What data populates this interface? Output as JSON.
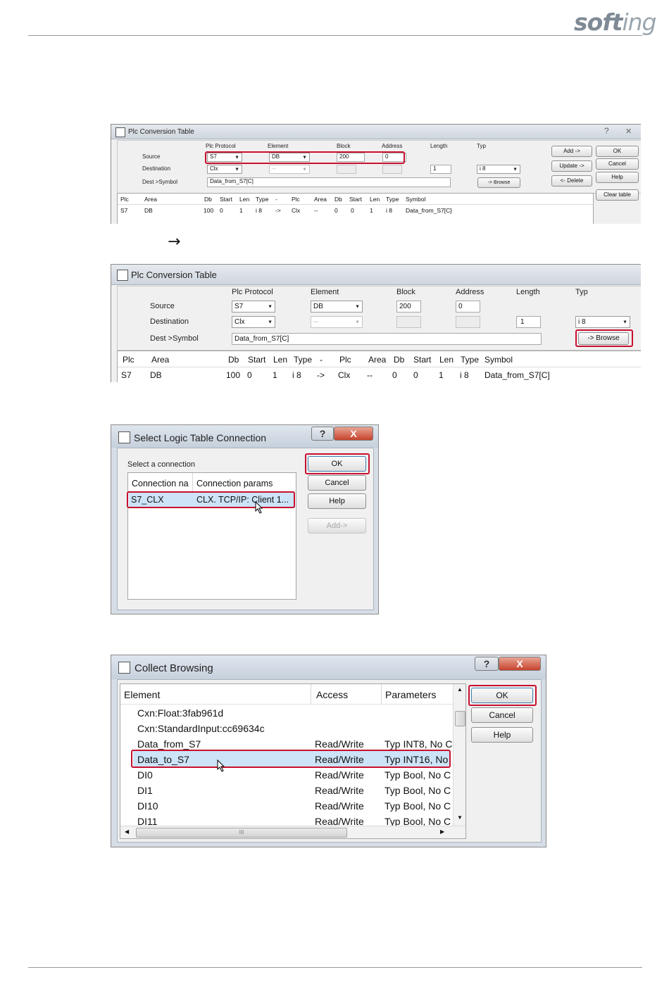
{
  "header": {
    "logo_main": "soft",
    "logo_tail": "ing"
  },
  "arrow": "→",
  "win1": {
    "title": "Plc Conversion Table",
    "help_glyph": "?",
    "close_glyph": "✕",
    "col_plc_protocol": "Plc Protocol",
    "col_element": "Element",
    "col_block": "Block",
    "col_address": "Address",
    "col_length": "Length",
    "col_typ": "Typ",
    "row_source": "Source",
    "row_destination": "Destination",
    "row_dest_symbol": "Dest >Symbol",
    "src_protocol": "S7",
    "src_element": "DB",
    "src_block": "200",
    "src_address": "0",
    "dst_protocol": "Clx",
    "dst_element": "--",
    "dst_length": "1",
    "dst_typ": "i 8",
    "dest_symbol": "Data_from_S7[C]",
    "browse": "-> Browse",
    "add": "Add ->",
    "update": "Update ->",
    "delete": "<- Delete",
    "ok": "OK",
    "cancel": "Cancel",
    "help": "Help",
    "clear": "Clear table",
    "headers": [
      "Plc",
      "Area",
      "Db",
      "Start",
      "Len",
      "Type",
      "-",
      "Plc",
      "Area",
      "Db",
      "Start",
      "Len",
      "Type",
      "Symbol"
    ],
    "row": [
      "S7",
      "DB",
      "100",
      "0",
      "1",
      "i 8",
      "->",
      "Clx",
      "--",
      "0",
      "0",
      "1",
      "i 8",
      "Data_from_S7[C]"
    ]
  },
  "win2": {
    "title": "Plc Conversion Table",
    "col_plc_protocol": "Plc Protocol",
    "col_element": "Element",
    "col_block": "Block",
    "col_address": "Address",
    "col_length": "Length",
    "col_typ": "Typ",
    "row_source": "Source",
    "row_destination": "Destination",
    "row_dest_symbol": "Dest >Symbol",
    "src_protocol": "S7",
    "src_element": "DB",
    "src_block": "200",
    "src_address": "0",
    "dst_protocol": "Clx",
    "dst_element": "--",
    "dst_length": "1",
    "dst_typ": "i 8",
    "dest_symbol": "Data_from_S7[C]",
    "browse": "-> Browse",
    "headers": [
      "Plc",
      "Area",
      "Db",
      "Start",
      "Len",
      "Type",
      "-",
      "Plc",
      "Area",
      "Db",
      "Start",
      "Len",
      "Type",
      "Symbol"
    ],
    "row": [
      "S7",
      "DB",
      "100",
      "0",
      "1",
      "i 8",
      "->",
      "Clx",
      "--",
      "0",
      "0",
      "1",
      "i 8",
      "Data_from_S7[C]"
    ]
  },
  "win3": {
    "title": "Select Logic Table Connection",
    "help_glyph": "?",
    "close_glyph": "X",
    "prompt": "Select a connection",
    "col_name": "Connection na",
    "col_params": "Connection params",
    "row_name": "S7_CLX",
    "row_params": "CLX. TCP/IP: Client 1...",
    "ok": "OK",
    "cancel": "Cancel",
    "help": "Help",
    "add": "Add->"
  },
  "win4": {
    "title": "Collect Browsing",
    "help_glyph": "?",
    "close_glyph": "X",
    "col_element": "Element",
    "col_access": "Access",
    "col_params": "Parameters",
    "rows": [
      {
        "element": "Cxn:Float:3fab961d",
        "access": "",
        "params": ""
      },
      {
        "element": "Cxn:StandardInput:cc69634c",
        "access": "",
        "params": ""
      },
      {
        "element": "Data_from_S7",
        "access": "Read/Write",
        "params": "Typ INT8, No C"
      },
      {
        "element": "Data_to_S7",
        "access": "Read/Write",
        "params": "Typ INT16, No"
      },
      {
        "element": "DI0",
        "access": "Read/Write",
        "params": "Typ Bool, No C"
      },
      {
        "element": "DI1",
        "access": "Read/Write",
        "params": "Typ Bool, No C"
      },
      {
        "element": "DI10",
        "access": "Read/Write",
        "params": "Typ Bool, No C"
      },
      {
        "element": "DI11",
        "access": "Read/Write",
        "params": "Typ Bool, No C"
      }
    ],
    "ok": "OK",
    "cancel": "Cancel",
    "help": "Help",
    "scroll_grip": "III"
  }
}
